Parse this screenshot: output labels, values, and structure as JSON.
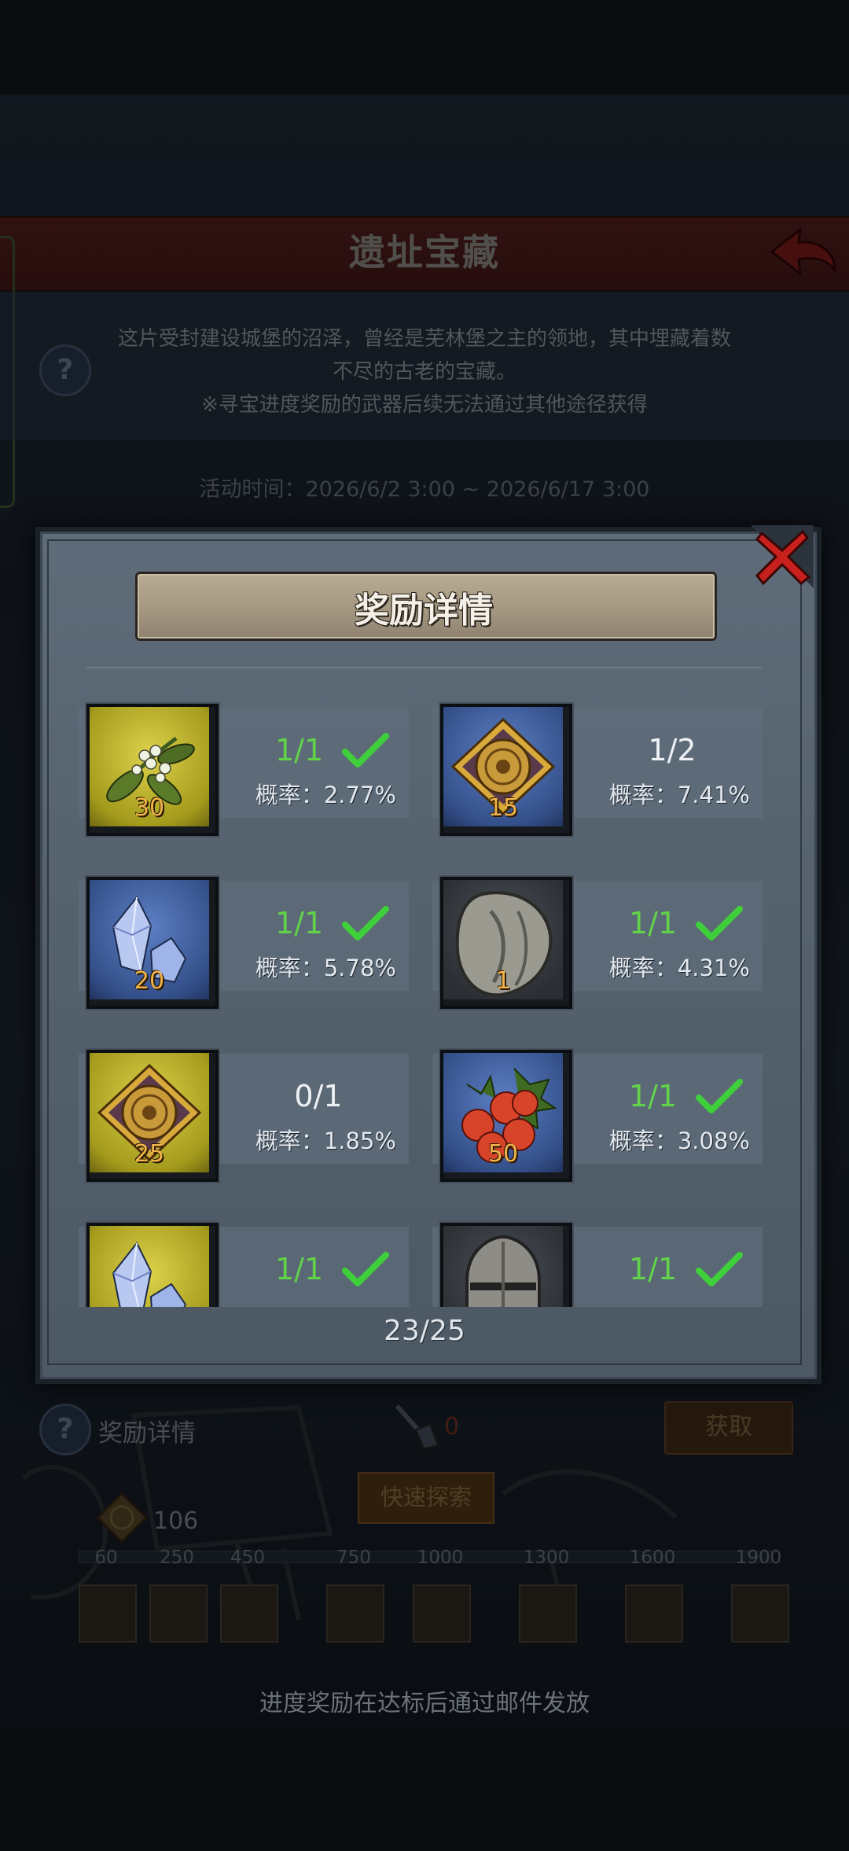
{
  "background": {
    "title": "遗址宝藏",
    "description_line1": "这片受封建设城堡的沼泽，曾经是芜林堡之主的领地，其中埋藏着数",
    "description_line2": "不尽的古老的宝藏。",
    "description_line3": "※寻宝进度奖励的武器后续无法通过其他途径获得",
    "activity_time_label": "活动时间：",
    "activity_time_value": "2026/6/2 3:00 ~ 2026/6/17 3:00",
    "reward_details_label": "奖励详情",
    "shovel_count": "0",
    "get_button": "获取",
    "quick_explore_button": "快速探索",
    "token_count": "106",
    "milestones": [
      "60",
      "250",
      "450",
      "750",
      "1000",
      "1300",
      "1600",
      "1900"
    ],
    "footer_text": "进度奖励在达标后通过邮件发放"
  },
  "modal": {
    "title": "奖励详情",
    "pager": "23/25",
    "items": [
      {
        "icon": "mistletoe-berries-icon",
        "bg": "yellow",
        "qty": "30",
        "count": "1/1",
        "done": true,
        "rate": "概率：2.77%"
      },
      {
        "icon": "rune-tablet-icon",
        "bg": "blue",
        "qty": "15",
        "count": "1/2",
        "done": false,
        "rate": "概率：7.41%"
      },
      {
        "icon": "crystal-icon",
        "bg": "blue",
        "qty": "20",
        "count": "1/1",
        "done": true,
        "rate": "概率：5.78%"
      },
      {
        "icon": "stone-shield-icon",
        "bg": "gray",
        "qty": "1",
        "count": "1/1",
        "done": true,
        "rate": "概率：4.31%"
      },
      {
        "icon": "rune-tablet-icon",
        "bg": "yellow",
        "qty": "25",
        "count": "0/1",
        "done": false,
        "rate": "概率：1.85%"
      },
      {
        "icon": "red-berries-icon",
        "bg": "blue",
        "qty": "50",
        "count": "1/1",
        "done": true,
        "rate": "概率：3.08%"
      },
      {
        "icon": "crystal-icon",
        "bg": "yellow",
        "qty": "",
        "count": "1/1",
        "done": true,
        "rate": ""
      },
      {
        "icon": "knight-helmet-icon",
        "bg": "gray",
        "qty": "",
        "count": "1/1",
        "done": true,
        "rate": ""
      }
    ]
  },
  "colors": {
    "done_green": "#62d24a",
    "qty_orange": "#f2b34c",
    "close_red": "#c8201c"
  }
}
